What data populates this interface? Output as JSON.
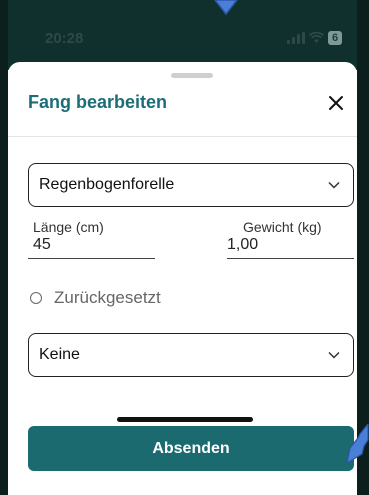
{
  "status_bar": {
    "time": "20:28",
    "battery": "6"
  },
  "sheet": {
    "title": "Fang bearbeiten",
    "species_select": {
      "value": "Regenbogenforelle"
    },
    "length": {
      "label": "Länge (cm)",
      "value": "45"
    },
    "weight": {
      "label": "Gewicht (kg)",
      "value": "1,00"
    },
    "released_option": {
      "label": "Zurückgesetzt",
      "checked": false
    },
    "extra_select": {
      "value": "Keine"
    },
    "submit_label": "Absenden"
  },
  "colors": {
    "accent": "#1a6a70",
    "status_bar_bg": "#10302e",
    "pointer": "#4a7fd8"
  },
  "icons": [
    "signal-icon",
    "wifi-icon",
    "close-icon",
    "chevron-down-icon",
    "pointer-arrow-icon"
  ]
}
